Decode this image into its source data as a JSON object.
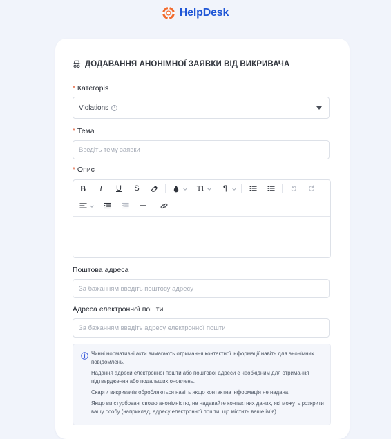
{
  "brand": {
    "name": "HelpDesk"
  },
  "form": {
    "title": "ДОДАВАННЯ АНОНІМНОЇ ЗАЯВКИ ВІД ВИКРИВАЧА",
    "category": {
      "required_mark": "*",
      "label": "Категорія",
      "value": "Violations",
      "info_glyph": "i"
    },
    "subject": {
      "required_mark": "*",
      "label": "Тема",
      "placeholder": "Введіть тему заявки",
      "value": ""
    },
    "description": {
      "required_mark": "*",
      "label": "Опис",
      "toolbar": {
        "bold": "B",
        "italic": "I",
        "underline": "U",
        "strike": "S",
        "text_size": "TI",
        "paragraph": "¶"
      },
      "value": ""
    },
    "postal": {
      "label": "Поштова адреса",
      "placeholder": "За бажанням введіть поштову адресу",
      "value": ""
    },
    "email": {
      "label": "Адреса електронної пошти",
      "placeholder": "За бажанням введіть адресу електронної пошти",
      "value": ""
    },
    "notice": {
      "paragraphs": [
        "Чинні нормативні акти вимагають отримання контактної інформації навіть для анонімних повідомлень.",
        "Надання адреси електронної пошти або поштової адреси є необхідним для отримання підтвердження або подальших оновлень.",
        "Скарги викривачів обробляються навіть якщо контактна інформація не надана.",
        "Якщо ви стурбовані своєю анонімністю, не надавайте контактних даних, які можуть розкрити вашу особу (наприклад, адресу електронної пошти, що містить ваше ім'я)."
      ]
    }
  },
  "icons": {
    "brand_logo": "lifebuoy-icon",
    "title_icon": "incognito-icon",
    "notice_icon": "info-circle-icon"
  },
  "colors": {
    "page_background": "#f1f4fb",
    "brand_text": "#1f56d6",
    "brand_logo": "#f26b2d",
    "required_mark": "#e0542c",
    "card_background": "#ffffff",
    "notice_background": "#f4f6fb",
    "notice_icon": "#3b5bdb"
  }
}
